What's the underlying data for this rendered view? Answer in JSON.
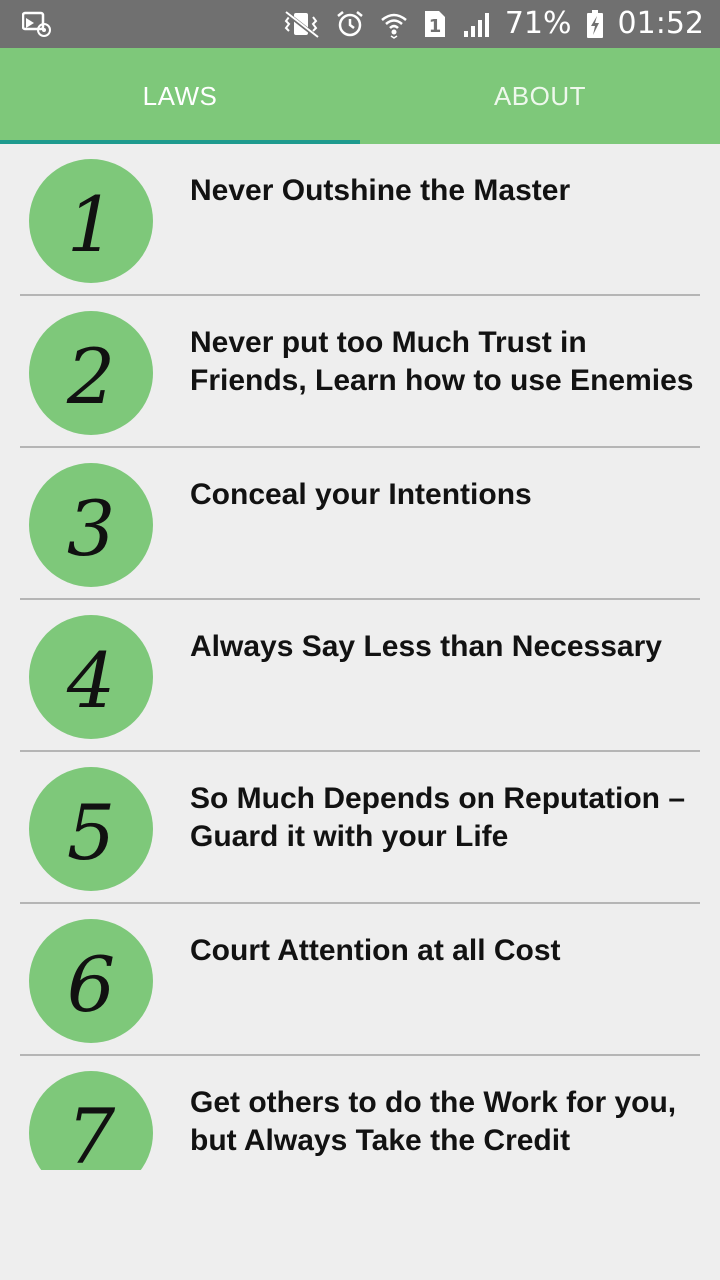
{
  "status_bar": {
    "battery_percent": "71%",
    "clock": "01:52",
    "sim_slot": "1",
    "icons": [
      "screen-recorder-icon",
      "vibrate-mute-icon",
      "alarm-icon",
      "wifi-icon",
      "sim-1-icon",
      "signal-icon",
      "battery-charging-icon"
    ]
  },
  "tabs": [
    {
      "label": "LAWS",
      "selected": true
    },
    {
      "label": "ABOUT",
      "selected": false
    }
  ],
  "colors": {
    "accent_green": "#7ec87a",
    "indicator": "#1e9a8e",
    "status_bar": "#707070",
    "background": "#eeeeee"
  },
  "laws": [
    {
      "number": "1",
      "title": "Never Outshine the Master"
    },
    {
      "number": "2",
      "title": "Never put too Much Trust in Friends, Learn how to use Enemies"
    },
    {
      "number": "3",
      "title": "Conceal your Intentions"
    },
    {
      "number": "4",
      "title": "Always Say Less than Necessary"
    },
    {
      "number": "5",
      "title": "So Much Depends on Reputation – Guard it with your Life"
    },
    {
      "number": "6",
      "title": "Court Attention at all Cost"
    },
    {
      "number": "7",
      "title": "Get others to do the Work for you, but Always Take the Credit"
    }
  ]
}
